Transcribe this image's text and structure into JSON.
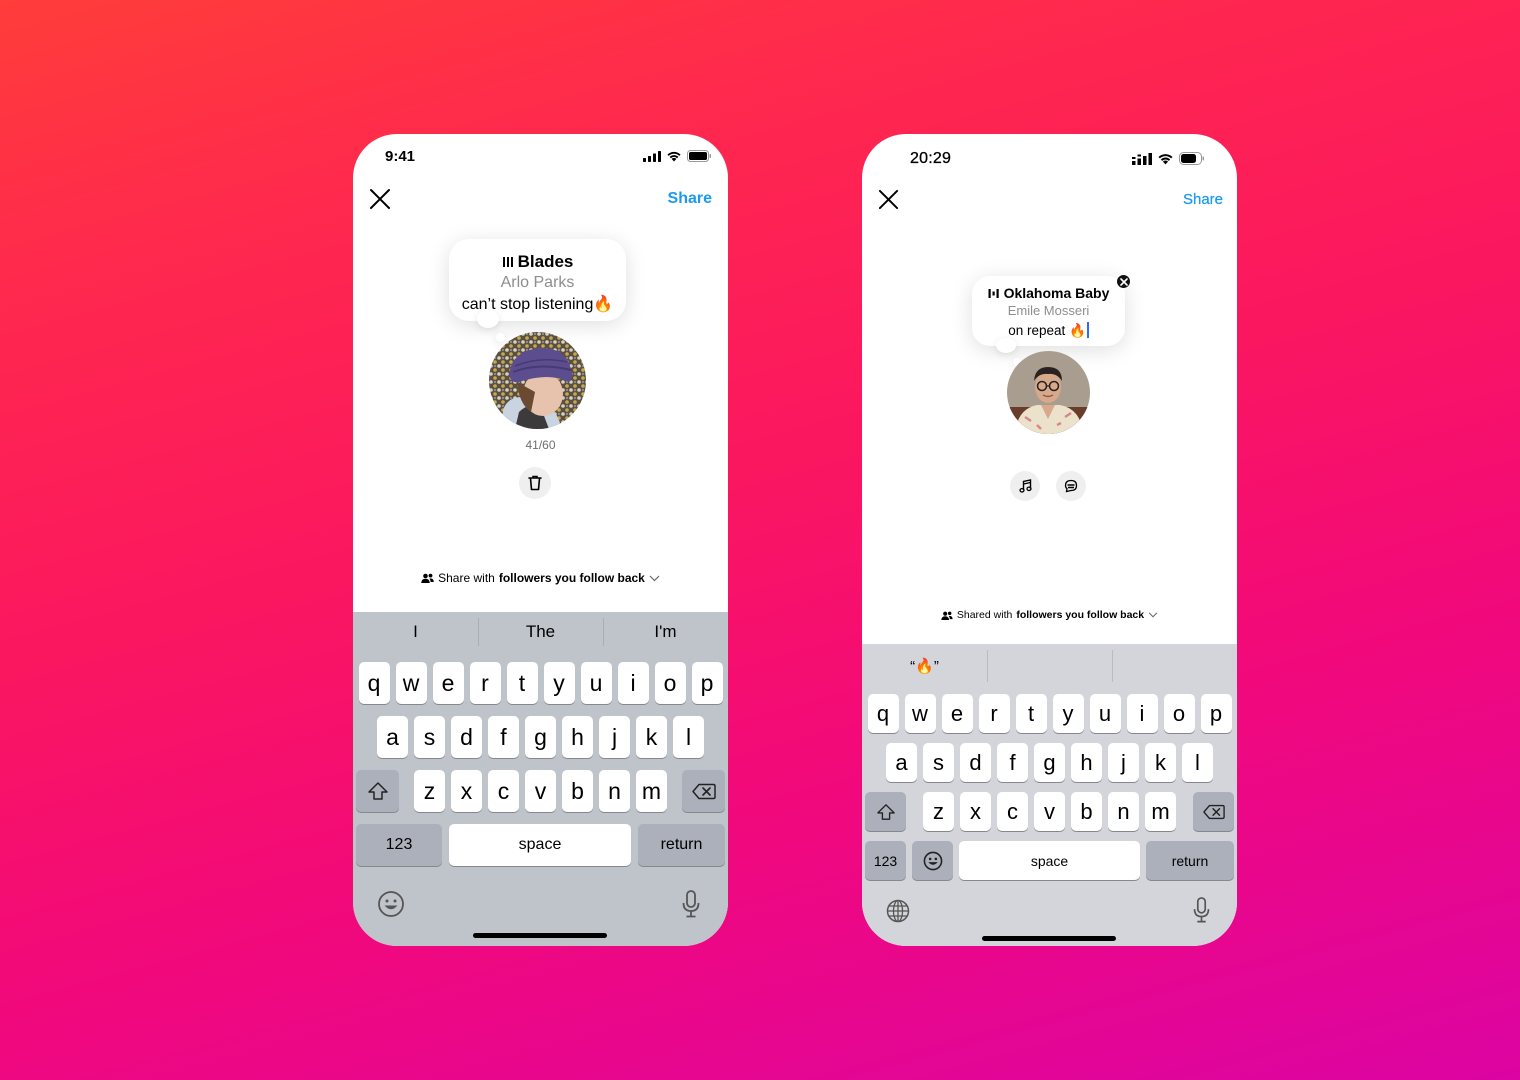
{
  "background": {
    "gradient_from": "#ff3d3a",
    "gradient_to": "#dc04a2"
  },
  "colors": {
    "accent": "#1b9af0",
    "cursor": "#2f6bff",
    "secondary_text": "#8e8e8e"
  },
  "phones": [
    {
      "status_bar": {
        "time": "9:41",
        "icons": [
          "signal-icon",
          "wifi-icon",
          "battery-icon"
        ]
      },
      "header": {
        "close_icon": "close-icon",
        "share_label": "Share"
      },
      "note": {
        "song_icon": "audio-bars-icon",
        "song_title": "Blades",
        "artist": "Arlo Parks",
        "text": "can’t stop listening🔥"
      },
      "avatar": {
        "description": "profile photo - person in purple hat"
      },
      "char_count": "41/60",
      "actions": [
        {
          "icon": "trash-icon",
          "label": "Delete"
        }
      ],
      "audience": {
        "icon": "people-icon",
        "prefix": "Share with ",
        "bold": "followers you follow back",
        "chevron": "chevron-down-icon"
      },
      "keyboard": {
        "suggestions": [
          "I",
          "The",
          "I'm"
        ],
        "row1": [
          "q",
          "w",
          "e",
          "r",
          "t",
          "y",
          "u",
          "i",
          "o",
          "p"
        ],
        "row2": [
          "a",
          "s",
          "d",
          "f",
          "g",
          "h",
          "j",
          "k",
          "l"
        ],
        "row3": [
          "z",
          "x",
          "c",
          "v",
          "b",
          "n",
          "m"
        ],
        "numbers_label": "123",
        "space_label": "space",
        "return_label": "return",
        "bottom_left_icon": "emoji-icon",
        "bottom_right_icon": "microphone-icon"
      }
    },
    {
      "status_bar": {
        "time": "20:29",
        "icons": [
          "signal-icon",
          "wifi-icon",
          "battery-icon"
        ]
      },
      "header": {
        "close_icon": "close-icon",
        "share_label": "Share"
      },
      "note": {
        "song_icon": "audio-bars-icon",
        "song_title": "Oklahoma Baby",
        "artist": "Emile Mosseri",
        "text": "on repeat 🔥",
        "remove_icon": "remove-icon"
      },
      "avatar": {
        "description": "profile photo - man with glasses"
      },
      "actions": [
        {
          "icon": "music-note-icon",
          "label": "Music"
        },
        {
          "icon": "chat-bubble-icon",
          "label": "Note"
        }
      ],
      "audience": {
        "icon": "people-icon",
        "prefix": "Shared with ",
        "bold": "followers you follow back",
        "chevron": "chevron-down-icon"
      },
      "keyboard": {
        "suggestions": [
          "“🔥”",
          "",
          ""
        ],
        "row1": [
          "q",
          "w",
          "e",
          "r",
          "t",
          "y",
          "u",
          "i",
          "o",
          "p"
        ],
        "row2": [
          "a",
          "s",
          "d",
          "f",
          "g",
          "h",
          "j",
          "k",
          "l"
        ],
        "row3": [
          "z",
          "x",
          "c",
          "v",
          "b",
          "n",
          "m"
        ],
        "numbers_label": "123",
        "space_label": "space",
        "return_label": "return",
        "emoji_key_icon": "emoji-icon",
        "bottom_left_icon": "globe-icon",
        "bottom_right_icon": "microphone-icon"
      }
    }
  ]
}
